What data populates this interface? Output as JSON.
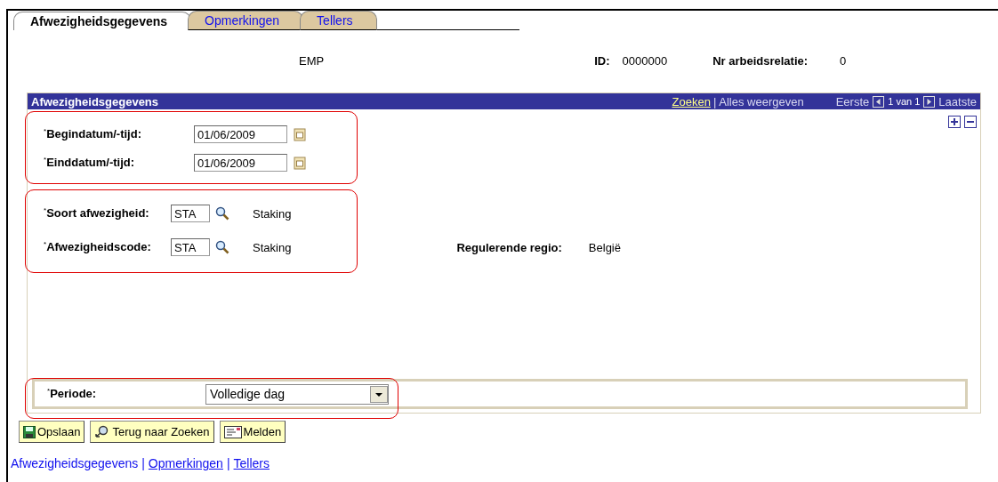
{
  "tabs": [
    {
      "label": "Afwezigheidsgegevens",
      "selected": true
    },
    {
      "label": "Opmerkingen",
      "selected": false
    },
    {
      "label": "Tellers",
      "selected": false
    }
  ],
  "header": {
    "name": "EMP",
    "id_label": "ID:",
    "id_value": "0000000",
    "relation_label": "Nr arbeidsrelatie:",
    "relation_value": "0"
  },
  "grid": {
    "title": "Afwezigheidsgegevens",
    "search_link": "Zoeken",
    "separator": "|",
    "show_all": "Alles weergeven",
    "first": "Eerste",
    "position": "1 van 1",
    "last": "Laatste",
    "dates": [
      {
        "label": "$^{*}$Begindatum/-tijd:",
        "value": "01/06/2009"
      },
      {
        "label": "$^{*}$Einddatum/-tijd:",
        "value": "01/06/2009"
      }
    ],
    "codes": [
      {
        "label": "$^{*}$Soort afwezigheid:",
        "value": "STA",
        "description": "Staking"
      },
      {
        "label": "$^{*}$Afwezigheidscode:",
        "value": "STA",
        "description": "Staking"
      }
    ],
    "region_label": "Regulerende regio:",
    "region_value": "België",
    "period_label": "$^{*}$Periode:",
    "period_value": "Volledige dag"
  },
  "buttons": [
    {
      "kind": "save",
      "label": "Opslaan"
    },
    {
      "kind": "search",
      "label": "Terug naar Zoeken"
    },
    {
      "kind": "notify",
      "label": "Melden"
    }
  ],
  "footer_links": [
    {
      "label": "Afwezigheidsgegevens",
      "selected": true
    },
    {
      "label": "Opmerkingen",
      "selected": false
    },
    {
      "label": "Tellers",
      "selected": false
    }
  ],
  "footer_separator": "|"
}
